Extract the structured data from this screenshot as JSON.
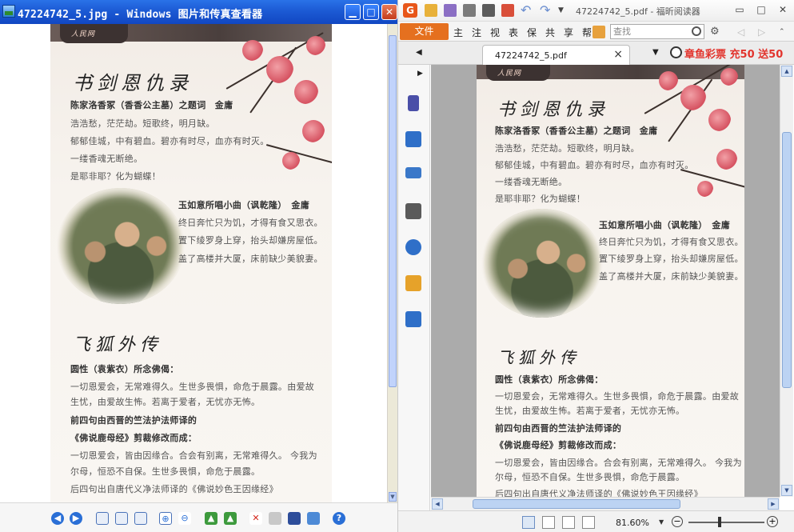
{
  "left_window": {
    "title": "47224742_5.jpg - Windows 图片和传真查看器",
    "buttons": {
      "minimize": "▁",
      "maximize": "□",
      "close": "✕"
    }
  },
  "right_window": {
    "title": "47224742_5.pdf - 福昕阅读器",
    "ribbon": {
      "file_tab": "文件",
      "tabs": [
        "主",
        "注",
        "视",
        "表",
        "保",
        "共",
        "享",
        "帮"
      ],
      "search_placeholder": "查找"
    },
    "doc_tab": {
      "label": "47224742_5.pdf",
      "close": "×"
    },
    "ad": {
      "text": "章鱼彩票 充50 送50"
    },
    "status": {
      "zoom": "81.60%"
    },
    "controls": {
      "prev_tab": "◀",
      "next_tab": "▶",
      "tab_menu": "▼",
      "zoom_out": "−",
      "zoom_in": "+"
    }
  },
  "document": {
    "heading1": "书剑恩仇录",
    "poem1_title": "陈家洛香冢（香香公主墓）之题词　金庸",
    "poem1_lines": [
      "浩浩愁，茫茫劫。短歌终，明月缺。",
      "郁郁佳城，中有碧血。碧亦有时尽，血亦有时灭。",
      "一缕香魂无断绝。",
      "是耶非耶？化为蝴蝶！"
    ],
    "poem2_title": "玉如意所唱小曲（讽乾隆）　金庸",
    "poem2_lines": [
      "终日奔忙只为饥，才得有食又思衣。",
      "置下绫罗身上穿，抬头却嫌房屋低。",
      "盖了高楼并大厦，床前缺少美貌妻。"
    ],
    "heading2": "飞狐外传",
    "section2_lines": [
      {
        "text": "圆性（袁紫衣）所念佛偈：",
        "bold": true
      },
      {
        "text": "一切恩爱会，无常难得久。生世多畏惧，命危于晨露。由爱故",
        "bold": false
      },
      {
        "text": "生忧，由爱故生怖。若离于爱者，无忧亦无怖。",
        "bold": false
      },
      {
        "text": "前四句由西晋的竺法护法师译的",
        "bold": true
      },
      {
        "text": "《佛说鹿母经》剪裁修改而成：",
        "bold": true
      },
      {
        "text": "一切恩爱会，皆由因缘合。合会有别离，无常难得久。 今我为",
        "bold": false
      },
      {
        "text": "尔母，恒恐不自保。生世多畏惧，命危于晨露。",
        "bold": false
      },
      {
        "text": "后四句出自唐代义净法师译的《佛说妙色王因缘经》",
        "bold": false
      }
    ],
    "logo": "人民网"
  },
  "colors": {
    "xp_title": "#1c5ad4",
    "foxit_orange": "#e5701f",
    "ad_red": "#e2342d",
    "blossom": "#d5505f"
  },
  "icons": {
    "left_toolbar": [
      "prev-image-icon",
      "next-image-icon",
      "best-fit-icon",
      "actual-size-icon",
      "slideshow-icon",
      "zoom-in-icon",
      "zoom-out-icon",
      "rotate-cw-icon",
      "rotate-ccw-icon",
      "delete-icon",
      "print-icon",
      "save-icon",
      "edit-icon",
      "help-icon"
    ],
    "right_sidebar": [
      "bookmark-icon",
      "pages-icon",
      "layers-icon",
      "comments-icon",
      "attachment-icon",
      "security-icon",
      "signature-icon"
    ]
  }
}
